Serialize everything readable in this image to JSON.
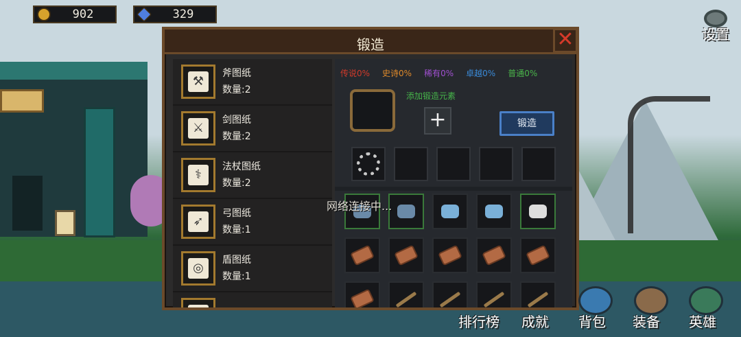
{
  "currency": {
    "gold": "902",
    "gems": "329"
  },
  "settings_label": "设置",
  "panel": {
    "title": "锻造",
    "close_label": "✕"
  },
  "blueprints": [
    {
      "name": "斧图纸",
      "qty": "数量:2",
      "glyph": "⚒"
    },
    {
      "name": "剑图纸",
      "qty": "数量:2",
      "glyph": "⚔"
    },
    {
      "name": "法杖图纸",
      "qty": "数量:2",
      "glyph": "⚕"
    },
    {
      "name": "弓图纸",
      "qty": "数量:1",
      "glyph": "➶"
    },
    {
      "name": "盾图纸",
      "qty": "数量:1",
      "glyph": "◎"
    },
    {
      "name": "",
      "qty": "",
      "glyph": ""
    }
  ],
  "rarity": [
    {
      "label": "传说0%",
      "color": "#d23a2a"
    },
    {
      "label": "史诗0%",
      "color": "#e08a2a"
    },
    {
      "label": "稀有0%",
      "color": "#a050d0"
    },
    {
      "label": "卓越0%",
      "color": "#3a8ad8"
    },
    {
      "label": "普通0%",
      "color": "#4ab44a"
    }
  ],
  "add_hint": "添加锻造元素",
  "add_symbol": "+",
  "forge_button": "锻造",
  "network_text": "网络连接中...",
  "materials": [
    [
      "ore",
      "ore",
      "ore-blue",
      "ore-blue",
      "ore-white"
    ],
    [
      "log",
      "log",
      "log",
      "log",
      "log"
    ],
    [
      "log",
      "stick",
      "stick",
      "stick",
      "stick"
    ]
  ],
  "menu": [
    {
      "label": "排行榜"
    },
    {
      "label": "成就"
    },
    {
      "label": "背包"
    },
    {
      "label": "装备"
    },
    {
      "label": "英雄"
    }
  ]
}
